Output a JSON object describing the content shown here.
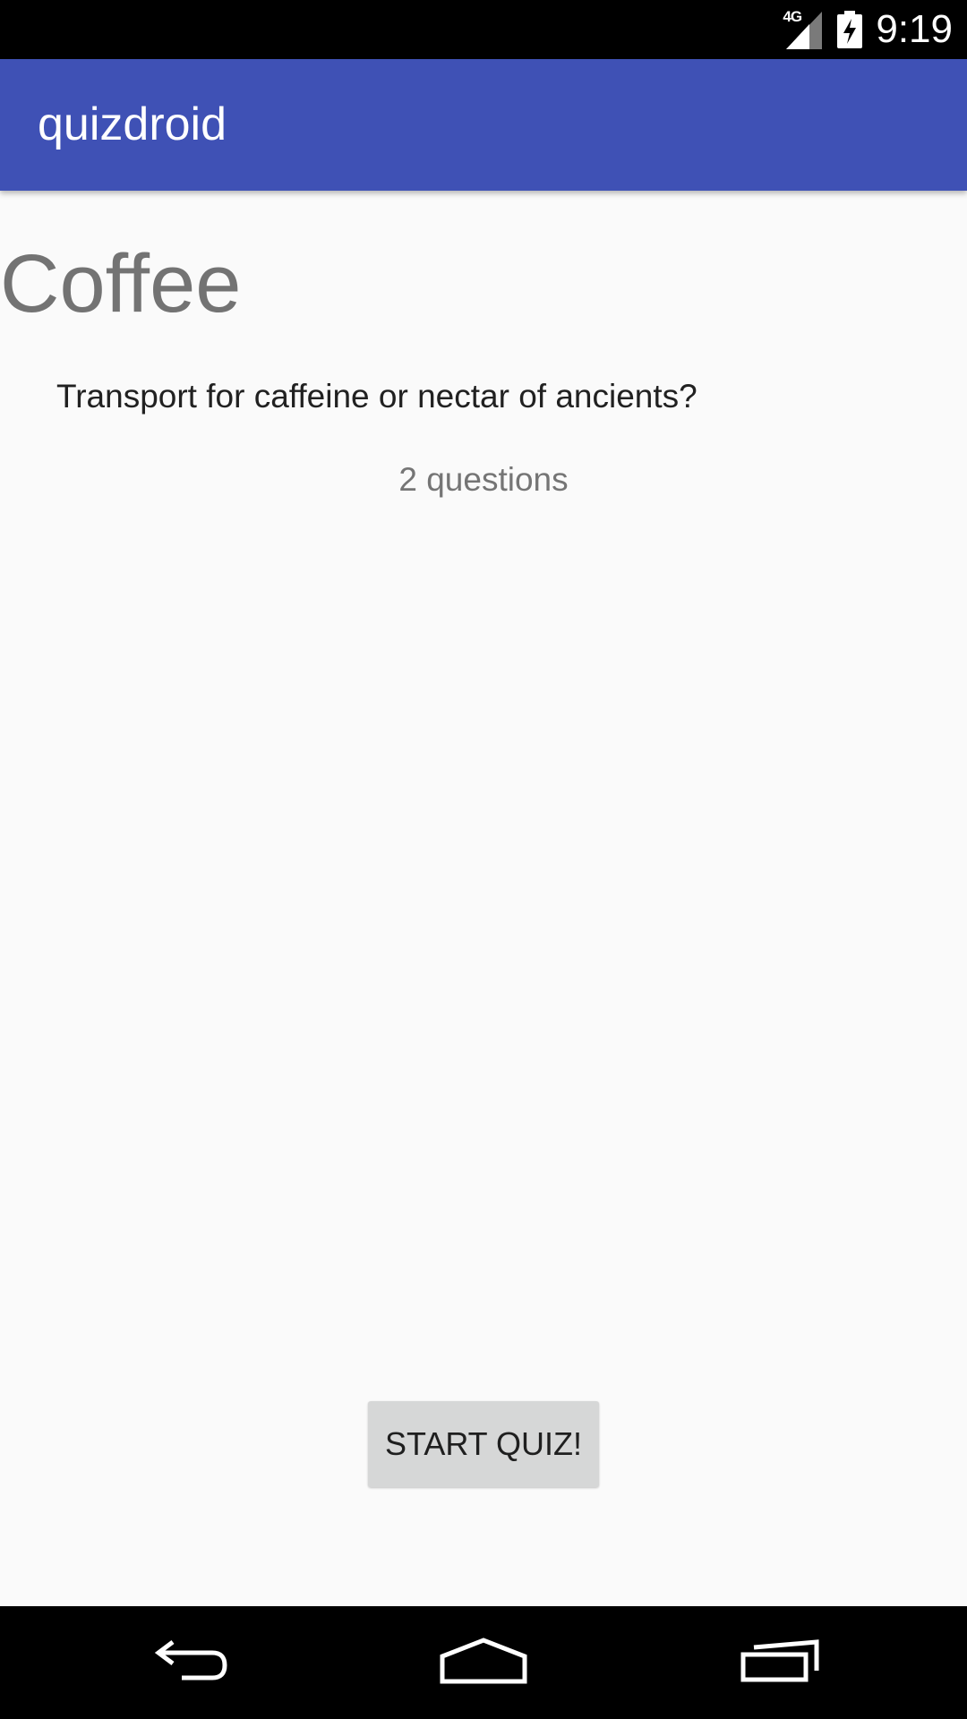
{
  "status_bar": {
    "network_type": "4G",
    "time": "9:19",
    "icons": [
      "signal-icon",
      "battery-charging-icon"
    ]
  },
  "app_bar": {
    "title": "quizdroid",
    "color": "#3f51b5"
  },
  "topic": {
    "title": "Coffee",
    "description": "Transport for caffeine or nectar of ancients?",
    "question_count": "2 questions"
  },
  "actions": {
    "start_label": "START QUIZ!"
  },
  "nav_bar": {
    "icons": [
      "back-icon",
      "home-icon",
      "recents-icon"
    ]
  }
}
